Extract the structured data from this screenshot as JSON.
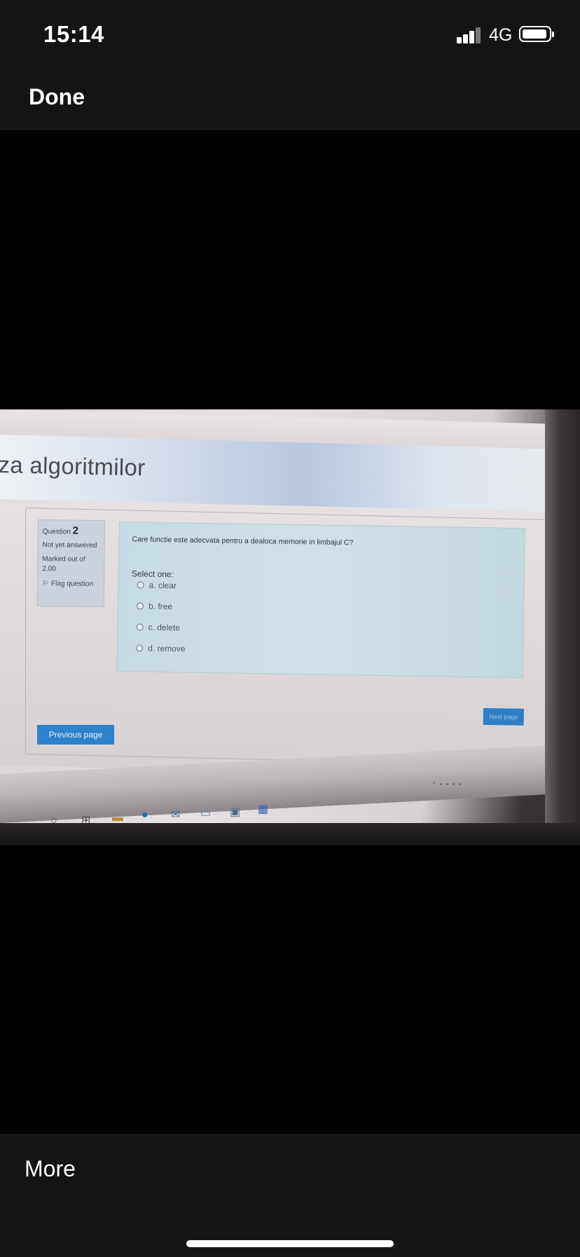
{
  "status_bar": {
    "time": "15:14",
    "network": "4G",
    "icons": [
      "signal-icon",
      "battery-icon"
    ]
  },
  "nav": {
    "done_label": "Done"
  },
  "photo": {
    "course_title": "za algoritmilor",
    "question": {
      "label": "Question",
      "number": "2",
      "state": "Not yet answered",
      "marked": "Marked out of 2.00",
      "flag_label": "Flag question",
      "text": "Care functie este adecvata pentru a dealoca memorie in limbajul C?",
      "select_label": "Select one:",
      "options": [
        "a. clear",
        "b. free",
        "c. delete",
        "d. remove"
      ]
    },
    "next_label": "Next page",
    "previous_label": "Previous page"
  },
  "bottom": {
    "more_label": "More"
  }
}
